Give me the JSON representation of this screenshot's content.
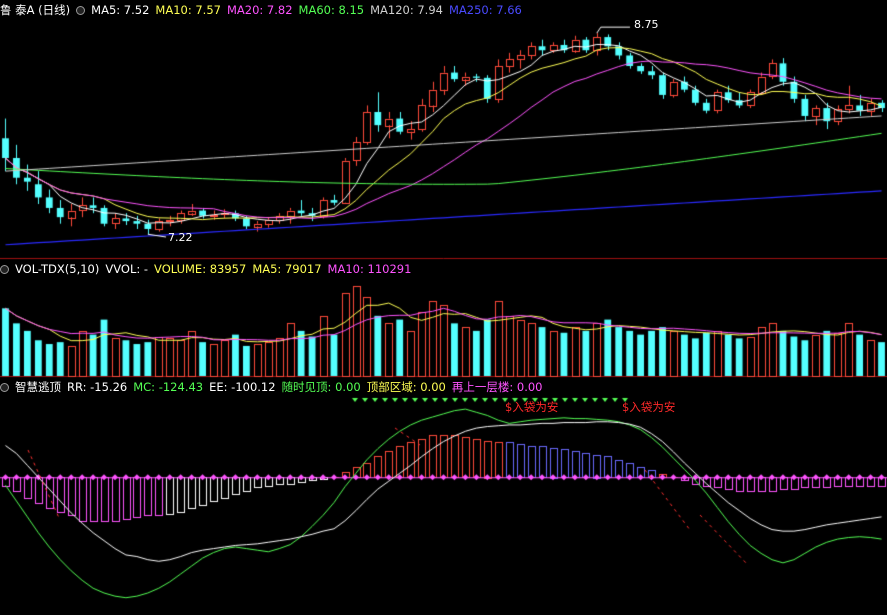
{
  "colors": {
    "bg": "#000000",
    "up": "#ff4a3a",
    "down": "#54ffff",
    "white": "#ffffff",
    "yellow": "#ffff54",
    "magenta": "#ff54ff",
    "green": "#54ff54",
    "blue": "#2a2aff",
    "grey": "#cfcfcf",
    "separator": "#a01010"
  },
  "price_panel": {
    "title": "鲁 泰A (日线)",
    "ma5": "MA5: 7.52",
    "ma10": "MA10: 7.57",
    "ma20": "MA20: 7.82",
    "ma60": "MA60: 8.15",
    "ma120": "MA120: 7.94",
    "ma250": "MA250: 7.66",
    "high_label": "8.75",
    "low_label": "7.22"
  },
  "volume_panel": {
    "name": "VOL-TDX(5,10)",
    "vvol": "VVOL: -",
    "volume": "VOLUME: 83957",
    "ma5": "MA5: 79017",
    "ma10": "MA10: 110291"
  },
  "indicator_panel": {
    "name": "智慧逃顶",
    "rr": "RR: -15.26",
    "mc": "MC: -124.43",
    "ee": "EE: -100.12",
    "ss": "随时见顶: 0.00",
    "tz": "顶部区域: 0.00",
    "zs": "再上一层楼: 0.00",
    "signal_1": "$入袋为安",
    "signal_2": "$入袋为安"
  },
  "chart_data": {
    "type": "candlestick",
    "ohlc": [
      [
        7.95,
        8.1,
        7.7,
        7.8
      ],
      [
        7.8,
        7.9,
        7.6,
        7.65
      ],
      [
        7.65,
        7.75,
        7.55,
        7.62
      ],
      [
        7.6,
        7.7,
        7.45,
        7.5
      ],
      [
        7.5,
        7.56,
        7.38,
        7.42
      ],
      [
        7.42,
        7.48,
        7.3,
        7.35
      ],
      [
        7.35,
        7.45,
        7.28,
        7.4
      ],
      [
        7.4,
        7.5,
        7.35,
        7.44
      ],
      [
        7.44,
        7.5,
        7.38,
        7.42
      ],
      [
        7.42,
        7.44,
        7.28,
        7.3
      ],
      [
        7.3,
        7.38,
        7.26,
        7.34
      ],
      [
        7.34,
        7.38,
        7.29,
        7.32
      ],
      [
        7.32,
        7.36,
        7.26,
        7.3
      ],
      [
        7.3,
        7.33,
        7.22,
        7.26
      ],
      [
        7.26,
        7.34,
        7.24,
        7.32
      ],
      [
        7.32,
        7.36,
        7.28,
        7.33
      ],
      [
        7.33,
        7.4,
        7.3,
        7.38
      ],
      [
        7.38,
        7.45,
        7.36,
        7.4
      ],
      [
        7.4,
        7.42,
        7.34,
        7.36
      ],
      [
        7.36,
        7.4,
        7.33,
        7.37
      ],
      [
        7.37,
        7.41,
        7.34,
        7.38
      ],
      [
        7.38,
        7.4,
        7.32,
        7.34
      ],
      [
        7.34,
        7.36,
        7.26,
        7.28
      ],
      [
        7.28,
        7.32,
        7.24,
        7.3
      ],
      [
        7.3,
        7.35,
        7.27,
        7.33
      ],
      [
        7.33,
        7.38,
        7.3,
        7.36
      ],
      [
        7.36,
        7.42,
        7.3,
        7.4
      ],
      [
        7.4,
        7.48,
        7.36,
        7.38
      ],
      [
        7.38,
        7.42,
        7.32,
        7.36
      ],
      [
        7.36,
        7.5,
        7.34,
        7.48
      ],
      [
        7.48,
        7.52,
        7.44,
        7.46
      ],
      [
        7.46,
        7.8,
        7.45,
        7.78
      ],
      [
        7.78,
        7.96,
        7.74,
        7.92
      ],
      [
        7.92,
        8.2,
        7.9,
        8.15
      ],
      [
        8.15,
        8.3,
        8.0,
        8.05
      ],
      [
        8.05,
        8.15,
        7.95,
        8.1
      ],
      [
        8.1,
        8.15,
        7.98,
        8.0
      ],
      [
        8.0,
        8.08,
        7.94,
        8.02
      ],
      [
        8.02,
        8.25,
        8.0,
        8.2
      ],
      [
        8.2,
        8.38,
        8.15,
        8.32
      ],
      [
        8.32,
        8.5,
        8.28,
        8.45
      ],
      [
        8.45,
        8.5,
        8.38,
        8.4
      ],
      [
        8.4,
        8.45,
        8.35,
        8.42
      ],
      [
        8.42,
        8.44,
        8.38,
        8.41
      ],
      [
        8.41,
        8.43,
        8.22,
        8.25
      ],
      [
        8.25,
        8.55,
        8.22,
        8.5
      ],
      [
        8.5,
        8.6,
        8.45,
        8.55
      ],
      [
        8.55,
        8.62,
        8.48,
        8.58
      ],
      [
        8.58,
        8.68,
        8.55,
        8.65
      ],
      [
        8.65,
        8.7,
        8.58,
        8.62
      ],
      [
        8.62,
        8.68,
        8.6,
        8.66
      ],
      [
        8.66,
        8.7,
        8.6,
        8.62
      ],
      [
        8.62,
        8.73,
        8.6,
        8.7
      ],
      [
        8.7,
        8.72,
        8.6,
        8.62
      ],
      [
        8.62,
        8.75,
        8.58,
        8.72
      ],
      [
        8.72,
        8.74,
        8.62,
        8.65
      ],
      [
        8.65,
        8.68,
        8.55,
        8.58
      ],
      [
        8.58,
        8.6,
        8.48,
        8.5
      ],
      [
        8.5,
        8.52,
        8.44,
        8.46
      ],
      [
        8.46,
        8.5,
        8.4,
        8.43
      ],
      [
        8.43,
        8.45,
        8.25,
        8.28
      ],
      [
        8.28,
        8.4,
        8.26,
        8.38
      ],
      [
        8.38,
        8.42,
        8.3,
        8.32
      ],
      [
        8.32,
        8.35,
        8.2,
        8.22
      ],
      [
        8.22,
        8.25,
        8.14,
        8.16
      ],
      [
        8.16,
        8.32,
        8.14,
        8.3
      ],
      [
        8.3,
        8.35,
        8.22,
        8.24
      ],
      [
        8.24,
        8.3,
        8.18,
        8.2
      ],
      [
        8.2,
        8.32,
        8.18,
        8.3
      ],
      [
        8.3,
        8.45,
        8.28,
        8.42
      ],
      [
        8.42,
        8.55,
        8.4,
        8.52
      ],
      [
        8.52,
        8.56,
        8.35,
        8.38
      ],
      [
        8.38,
        8.42,
        8.22,
        8.25
      ],
      [
        8.25,
        8.28,
        8.08,
        8.12
      ],
      [
        8.12,
        8.2,
        8.05,
        8.18
      ],
      [
        8.18,
        8.22,
        8.02,
        8.08
      ],
      [
        8.08,
        8.2,
        8.05,
        8.17
      ],
      [
        8.17,
        8.35,
        8.14,
        8.2
      ],
      [
        8.2,
        8.28,
        8.12,
        8.16
      ],
      [
        8.16,
        8.25,
        8.12,
        8.22
      ],
      [
        8.22,
        8.24,
        8.15,
        8.18
      ]
    ],
    "volume": [
      180,
      140,
      120,
      95,
      85,
      90,
      80,
      120,
      110,
      150,
      100,
      95,
      85,
      90,
      105,
      100,
      95,
      120,
      90,
      85,
      95,
      110,
      80,
      85,
      90,
      100,
      140,
      120,
      105,
      160,
      110,
      220,
      240,
      210,
      160,
      140,
      150,
      120,
      170,
      200,
      190,
      140,
      130,
      120,
      150,
      200,
      160,
      150,
      140,
      130,
      120,
      115,
      130,
      120,
      140,
      150,
      130,
      120,
      110,
      120,
      130,
      120,
      110,
      100,
      115,
      120,
      110,
      100,
      105,
      130,
      140,
      120,
      105,
      95,
      110,
      120,
      115,
      140,
      110,
      95,
      90
    ],
    "ma_series": [
      {
        "name": "MA5",
        "color": "#ffff54"
      },
      {
        "name": "MA10",
        "color": "#ffffff"
      },
      {
        "name": "MA20",
        "color": "#ff54ff"
      },
      {
        "name": "MA60",
        "color": "#54ff54"
      },
      {
        "name": "MA120",
        "color": "#cfcfcf"
      },
      {
        "name": "MA250",
        "color": "#2a2aff"
      }
    ],
    "price_range": [
      7.1,
      8.85
    ],
    "indicator": {
      "rr": [
        40,
        30,
        15,
        0,
        -15,
        -30,
        -45,
        -58,
        -70,
        -80,
        -90,
        -98,
        -100,
        -104,
        -106,
        -104,
        -100,
        -95,
        -92,
        -90,
        -88,
        -86,
        -85,
        -84,
        -82,
        -80,
        -78,
        -75,
        -72,
        -68,
        -65,
        -55,
        -42,
        -28,
        -15,
        -5,
        5,
        15,
        26,
        36,
        45,
        52,
        58,
        62,
        64,
        65,
        66,
        66,
        67,
        68,
        68,
        69,
        69,
        69,
        70,
        70,
        69,
        67,
        63,
        55,
        45,
        32,
        18,
        5,
        -8,
        -20,
        -32,
        -42,
        -52,
        -60,
        -66,
        -68,
        -68,
        -66,
        -63,
        -60,
        -58,
        -56,
        -54,
        -52,
        -50
      ],
      "mc": [
        -10,
        -30,
        -50,
        -70,
        -88,
        -104,
        -118,
        -130,
        -140,
        -146,
        -150,
        -152,
        -150,
        -146,
        -140,
        -132,
        -122,
        -112,
        -102,
        -95,
        -90,
        -88,
        -90,
        -92,
        -94,
        -90,
        -85,
        -75,
        -62,
        -48,
        -32,
        -12,
        5,
        22,
        36,
        48,
        58,
        66,
        72,
        76,
        80,
        84,
        86,
        82,
        78,
        72,
        68,
        70,
        72,
        73,
        74,
        75,
        74,
        74,
        73,
        72,
        70,
        66,
        60,
        50,
        38,
        24,
        10,
        -4,
        -20,
        -38,
        -56,
        -72,
        -86,
        -96,
        -104,
        -108,
        -104,
        -96,
        -88,
        -82,
        -78,
        -76,
        -75,
        -76,
        -78
      ],
      "bars": [
        -5,
        -8,
        -12,
        -15,
        -18,
        -20,
        -22,
        -25,
        -25,
        -25,
        -25,
        -24,
        -23,
        -22,
        -22,
        -21,
        -20,
        -18,
        -16,
        -14,
        -12,
        -10,
        -8,
        -6,
        -5,
        -4,
        -4,
        -3,
        -2,
        -1,
        0,
        3,
        6,
        8,
        12,
        15,
        18,
        20,
        22,
        24,
        24,
        24,
        23,
        22,
        21,
        20,
        20,
        19,
        18,
        18,
        17,
        16,
        15,
        14,
        13,
        12,
        10,
        8,
        6,
        4,
        2,
        0,
        -2,
        -4,
        -5,
        -6,
        -7,
        -8,
        -8,
        -8,
        -8,
        -7,
        -7,
        -6,
        -6,
        -6,
        -5,
        -5,
        -5,
        -5,
        -5
      ],
      "range": [
        -170,
        100
      ]
    }
  }
}
